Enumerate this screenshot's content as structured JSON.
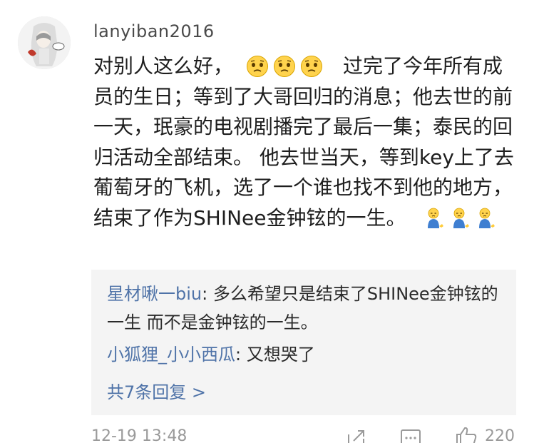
{
  "comment": {
    "username": "lanyiban2016",
    "text_before": "对别人这么好，",
    "emojis_sad": [
      "sad-face",
      "sad-face",
      "sad-face"
    ],
    "text_main": "过完了今年所有成员的生日；等到了大哥回归的消息；他去世的前一天，珉豪的电视剧播完了最后一集；泰民的回归活动全部结束。 他去世当天，等到key上了去葡萄牙的飞机，选了一个谁也找不到他的地方，结束了作为SHINee金钟铉的一生。",
    "emojis_kneel": [
      "kneeling-figure",
      "kneeling-figure",
      "kneeling-figure"
    ]
  },
  "replies": [
    {
      "name": "星材啾一biu",
      "text": "多么希望只是结束了SHINee金钟铉的一生 而不是金钟铉的一生。"
    },
    {
      "name": "小狐狸_小小西瓜",
      "text": "又想哭了"
    }
  ],
  "more_replies": "共7条回复 >",
  "footer": {
    "timestamp": "12-19 13:48",
    "like_count": "220",
    "icons": [
      "share-icon",
      "comment-icon",
      "like-icon"
    ]
  }
}
